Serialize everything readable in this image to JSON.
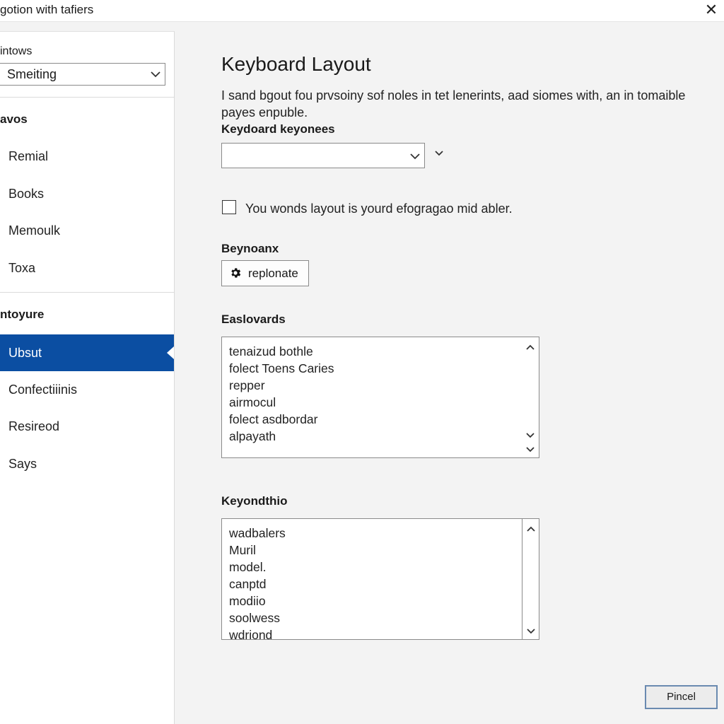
{
  "window": {
    "title": "gotion with tafiers",
    "close_glyph": "✕"
  },
  "sidebar": {
    "section_label": "intows",
    "dropdown_value": "Smeiting",
    "group1_header": "avos",
    "group1_items": [
      "Remial",
      "Books",
      "Memoulk",
      "Toxa"
    ],
    "group2_header": "ntoyure",
    "group2_items": [
      "Ubsut",
      "Confectiiinis",
      "Resireod",
      "Says"
    ],
    "selected_item": "Ubsut",
    "selected_color": "#0b4ea2"
  },
  "main": {
    "title": "Keyboard Layout",
    "description": "I sand bgout fou prvsoiny sof noles in tet lenerints, aad siomes with, an in tomaible payes enpuble.",
    "keyboard_label": "Keydoard keyonees",
    "keyboard_select_value": "",
    "checkbox_label": "You wonds layout is yourd efogragao mid abler.",
    "checkbox_checked": false,
    "beyond_label": "Beynoanx",
    "action_button_label": "replonate",
    "action_button_icon": "gear-icon",
    "list1_label": "Easlovards",
    "list1_items": [
      "tenaizud bothle",
      "folect Toens Caries",
      "repper",
      "airmocul",
      "folect asdbordar",
      "alpayath"
    ],
    "list2_label": "Keyondthio",
    "list2_items": [
      "wadbalers",
      "Muril",
      "model.",
      "canptd",
      "modiio",
      "soolwess",
      "wdriond"
    ],
    "cancel_label": "Pincel"
  }
}
